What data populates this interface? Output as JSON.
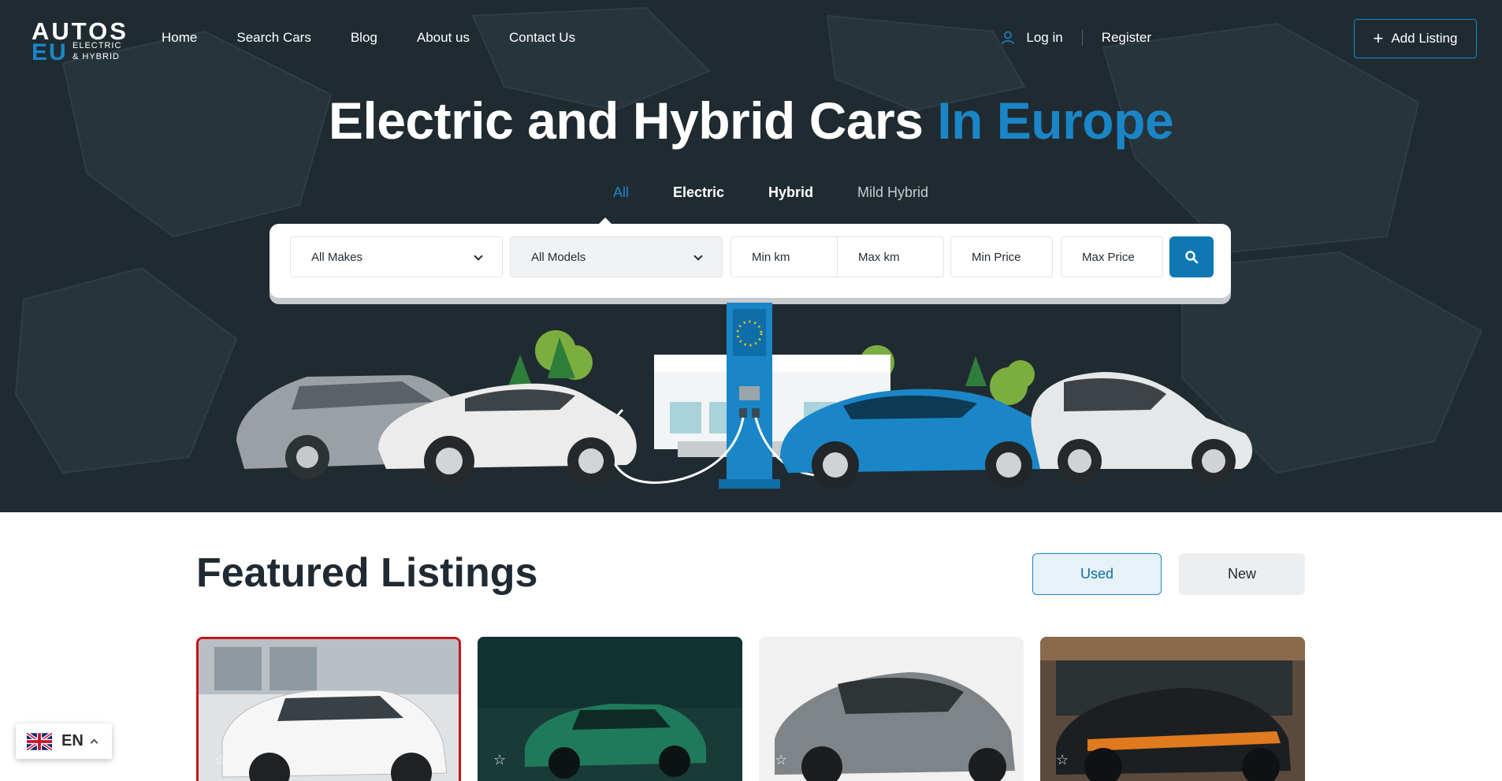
{
  "brand": {
    "name_top": "AUTOS",
    "name_bottom": "EU",
    "tagline_1": "ELECTRIC",
    "tagline_2": "& HYBRID"
  },
  "nav": {
    "items": [
      "Home",
      "Search Cars",
      "Blog",
      "About us",
      "Contact Us"
    ]
  },
  "account": {
    "login": "Log in",
    "register": "Register",
    "add_listing": "Add Listing"
  },
  "hero": {
    "title_main": "Electric and Hybrid Cars",
    "title_accent": "In Europe"
  },
  "tabs": [
    "All",
    "Electric",
    "Hybrid",
    "Mild Hybrid"
  ],
  "active_tab": "All",
  "search": {
    "makes": "All Makes",
    "models": "All Models",
    "min_km": "Min km",
    "max_km": "Max km",
    "min_price": "Min Price",
    "max_price": "Max Price"
  },
  "featured": {
    "title": "Featured Listings",
    "used": "Used",
    "new": "New"
  },
  "language": {
    "code": "EN"
  },
  "colors": {
    "brand_blue": "#1a86c7",
    "hero_bg": "#1f2b31",
    "highlight_red": "#c8141e"
  },
  "icons": [
    "user-icon",
    "plus-icon",
    "search-icon",
    "chevron-down-icon",
    "star-icon",
    "uk-flag-icon",
    "chevron-up-icon"
  ]
}
